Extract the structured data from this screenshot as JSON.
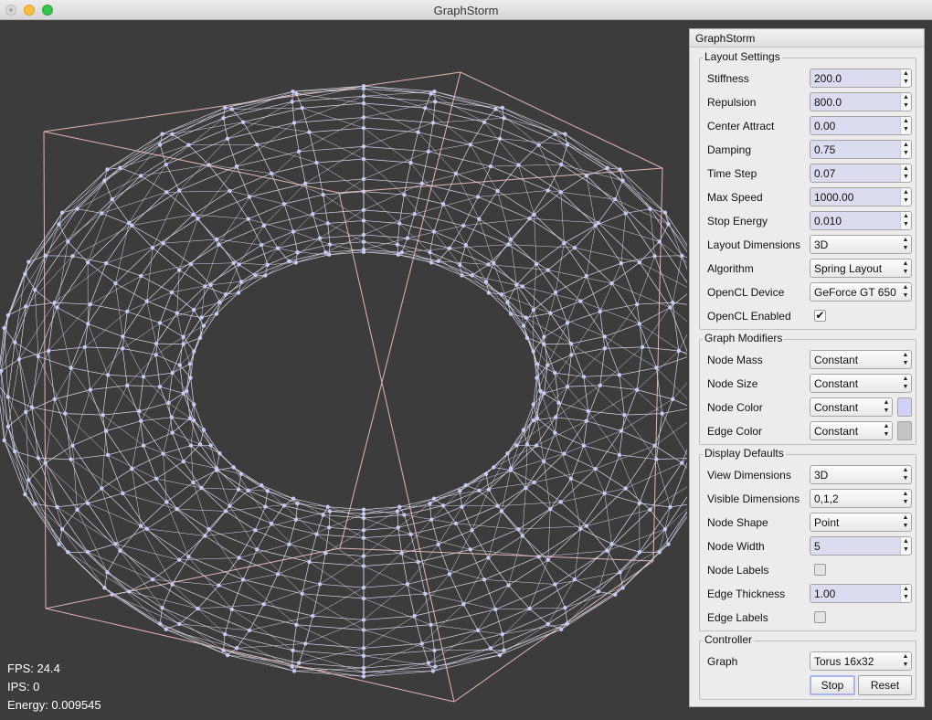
{
  "window": {
    "title": "GraphStorm"
  },
  "stats": {
    "fps": "FPS: 24.4",
    "ips": "IPS: 0",
    "energy": "Energy: 0.009545"
  },
  "colors": {
    "background": "#3c3c3c",
    "bounding_box": "#e8b3b3",
    "edges": "#d6d6e6",
    "nodes": "#c9c9f5",
    "node_color_swatch": "#d0d0f8",
    "edge_color_swatch": "#c4c4c4"
  },
  "panel": {
    "title": "GraphStorm",
    "layout": {
      "title": "Layout Settings",
      "stiffness": {
        "label": "Stiffness",
        "value": "200.0"
      },
      "repulsion": {
        "label": "Repulsion",
        "value": "800.0"
      },
      "center_attract": {
        "label": "Center Attract",
        "value": "0.00"
      },
      "damping": {
        "label": "Damping",
        "value": "0.75"
      },
      "time_step": {
        "label": "Time Step",
        "value": "0.07"
      },
      "max_speed": {
        "label": "Max Speed",
        "value": "1000.00"
      },
      "stop_energy": {
        "label": "Stop Energy",
        "value": "0.010"
      },
      "layout_dimensions": {
        "label": "Layout Dimensions",
        "value": "3D"
      },
      "algorithm": {
        "label": "Algorithm",
        "value": "Spring Layout"
      },
      "opencl_device": {
        "label": "OpenCL Device",
        "value": "GeForce GT 650"
      },
      "opencl_enabled": {
        "label": "OpenCL Enabled",
        "checked": true,
        "mark": "✔"
      }
    },
    "modifiers": {
      "title": "Graph Modifiers",
      "node_mass": {
        "label": "Node Mass",
        "value": "Constant"
      },
      "node_size": {
        "label": "Node Size",
        "value": "Constant"
      },
      "node_color": {
        "label": "Node Color",
        "value": "Constant"
      },
      "edge_color": {
        "label": "Edge Color",
        "value": "Constant"
      }
    },
    "display": {
      "title": "Display Defaults",
      "view_dimensions": {
        "label": "View Dimensions",
        "value": "3D"
      },
      "visible_dimensions": {
        "label": "Visible Dimensions",
        "value": "0,1,2"
      },
      "node_shape": {
        "label": "Node Shape",
        "value": "Point"
      },
      "node_width": {
        "label": "Node Width",
        "value": "5"
      },
      "node_labels": {
        "label": "Node Labels",
        "checked": false
      },
      "edge_thickness": {
        "label": "Edge Thickness",
        "value": "1.00"
      },
      "edge_labels": {
        "label": "Edge Labels",
        "checked": false
      }
    },
    "controller": {
      "title": "Controller",
      "graph": {
        "label": "Graph",
        "value": "Torus 16x32"
      },
      "stop_label": "Stop",
      "reset_label": "Reset"
    }
  }
}
